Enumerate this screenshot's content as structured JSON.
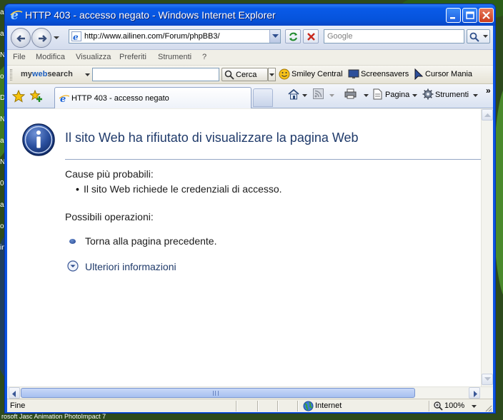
{
  "window": {
    "title": "HTTP 403 - accesso negato - Windows Internet Explorer"
  },
  "address_bar": {
    "url": "http://www.ailinen.com/Forum/phpBB3/",
    "search_placeholder": "Google"
  },
  "menu": {
    "items": [
      "File",
      "Modifica",
      "Visualizza",
      "Preferiti",
      "Strumenti",
      "?"
    ]
  },
  "mywebsearch": {
    "logo_prefix": "my",
    "logo_web": "web",
    "logo_suffix": "search",
    "search_value": "",
    "search_button": "Cerca",
    "links": [
      "Smiley Central",
      "Screensavers",
      "Cursor Mania"
    ]
  },
  "tabs": {
    "active_tab_label": "HTTP 403 - accesso negato"
  },
  "command_bar": {
    "page_label": "Pagina",
    "tools_label": "Strumenti",
    "overflow": "»"
  },
  "content": {
    "heading": "Il sito Web ha rifiutato di visualizzare la pagina Web",
    "causes_title": "Cause più probabili:",
    "causes": [
      "Il sito Web richiede le credenziali di accesso."
    ],
    "actions_title": "Possibili operazioni:",
    "back_link": "Torna alla pagina precedente.",
    "more_info": "Ulteriori informazioni"
  },
  "status": {
    "text": "Fine",
    "zone": "Internet",
    "zoom": "100%"
  },
  "desktop": {
    "side_letters": [
      "ar",
      "ar",
      "N",
      "ol",
      "D",
      "N",
      "ar",
      "N",
      "0",
      "ar",
      "o",
      "in"
    ],
    "taskbar_text": "rosoft     Jasc Animation   PhotoImpact 7"
  },
  "colors": {
    "title_bar": "#0654dc",
    "heading_text": "#1f3a6a",
    "link_text": "#1f3a6a"
  }
}
